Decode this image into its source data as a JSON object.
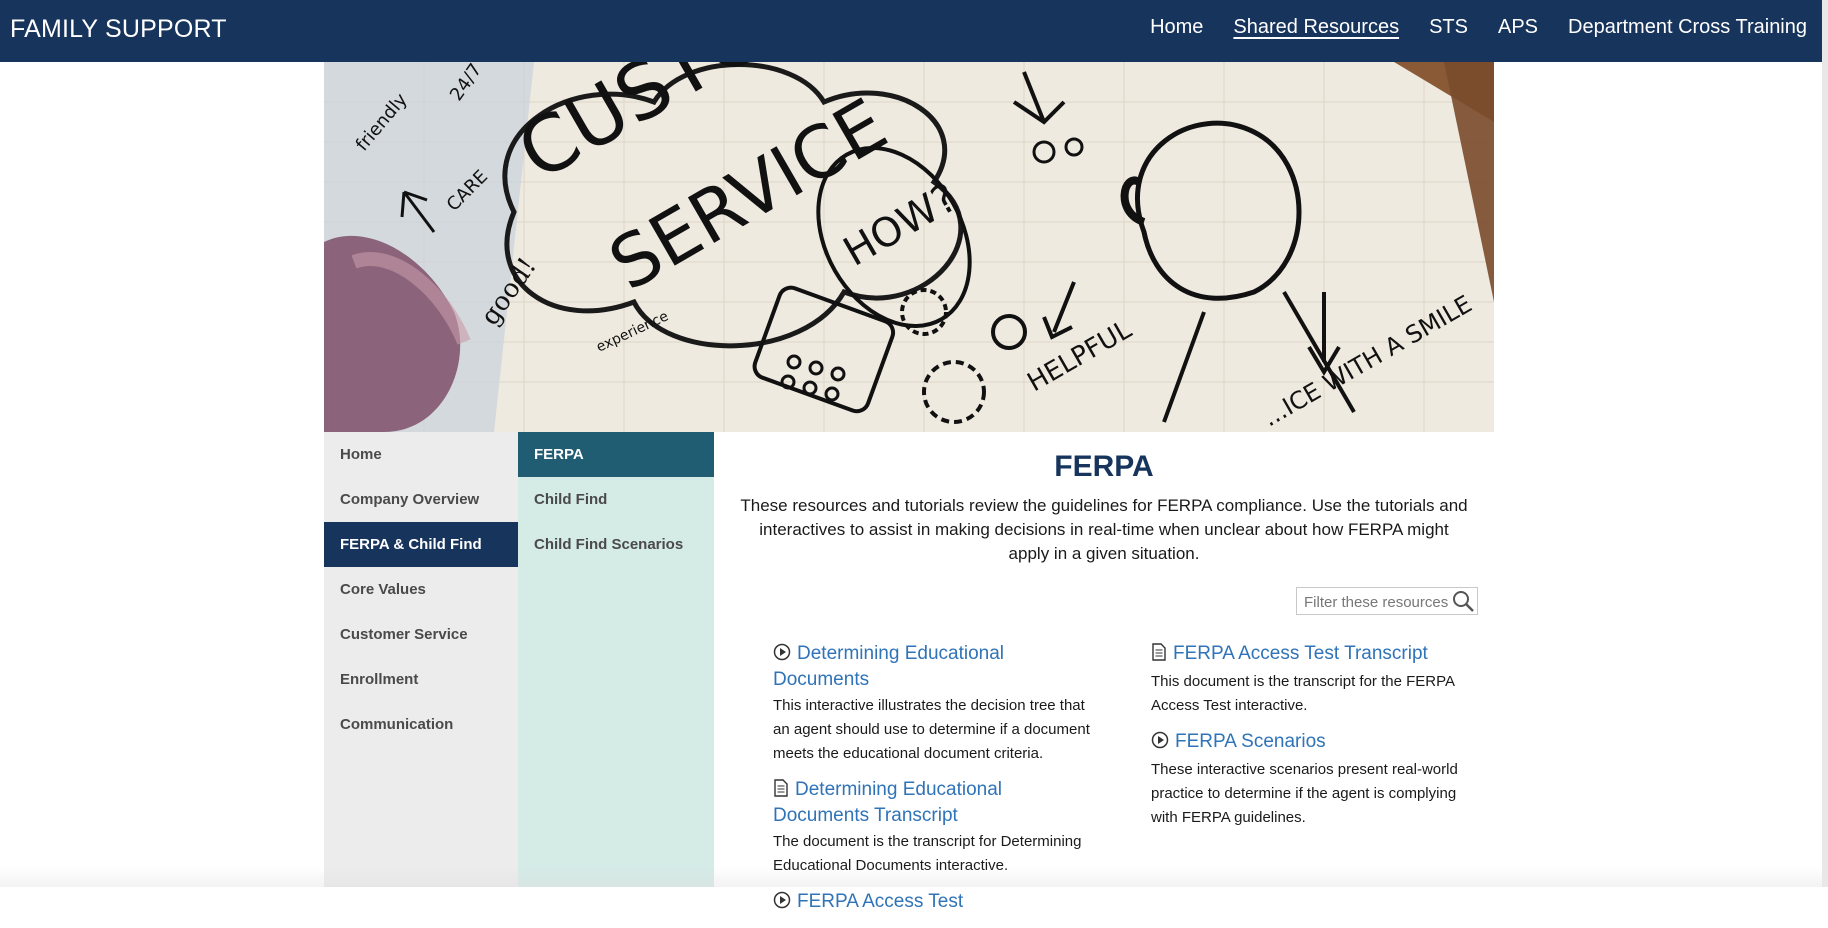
{
  "header": {
    "brand": "FAMILY SUPPORT",
    "nav": [
      {
        "label": "Home",
        "active": false
      },
      {
        "label": "Shared Resources",
        "active": true
      },
      {
        "label": "STS",
        "active": false
      },
      {
        "label": "APS",
        "active": false
      },
      {
        "label": "Department Cross Training",
        "active": false
      }
    ]
  },
  "hero": {
    "text": [
      "CUSTO",
      "SERVICE",
      "HOW?",
      "HELPFUL",
      "good!",
      "CARE",
      "24/7",
      "friendly",
      "experience",
      "...ICE WITH A SMILE"
    ]
  },
  "sidebar_primary": {
    "items": [
      {
        "label": "Home",
        "active": false
      },
      {
        "label": "Company Overview",
        "active": false
      },
      {
        "label": "FERPA & Child Find",
        "active": true
      },
      {
        "label": "Core Values",
        "active": false
      },
      {
        "label": "Customer Service",
        "active": false
      },
      {
        "label": "Enrollment",
        "active": false
      },
      {
        "label": "Communication",
        "active": false
      }
    ]
  },
  "sidebar_secondary": {
    "items": [
      {
        "label": "FERPA",
        "active": true
      },
      {
        "label": "Child Find",
        "active": false
      },
      {
        "label": "Child Find Scenarios",
        "active": false
      }
    ]
  },
  "main": {
    "title": "FERPA",
    "intro": "These resources and tutorials review the guidelines for FERPA compliance. Use the tutorials and interactives to assist in making decisions in real-time when unclear about how FERPA might apply in a given situation.",
    "filter_placeholder": "Filter these resources",
    "resources_left": [
      {
        "icon": "play-circle-icon",
        "title": "Determining Educational Documents",
        "desc": "This interactive illustrates the decision tree that an agent should use to determine if a document meets the educational document criteria."
      },
      {
        "icon": "document-icon",
        "title": "Determining Educational Documents Transcript",
        "desc": "The document is the transcript for Determining Educational Documents interactive."
      },
      {
        "icon": "play-circle-icon",
        "title": "FERPA Access Test",
        "desc": ""
      }
    ],
    "resources_right": [
      {
        "icon": "document-icon",
        "title": "FERPA Access Test Transcript",
        "desc": "This document is the transcript for the FERPA Access Test interactive."
      },
      {
        "icon": "play-circle-icon",
        "title": "FERPA Scenarios",
        "desc": "These interactive scenarios present real-world practice to determine if the agent is complying with FERPA guidelines."
      }
    ]
  },
  "colors": {
    "header_bg": "#17345c",
    "sidebar_active": "#17345c",
    "subnav_active": "#215d72",
    "subnav_bg": "#d5ebe6",
    "link": "#2f73b8"
  }
}
